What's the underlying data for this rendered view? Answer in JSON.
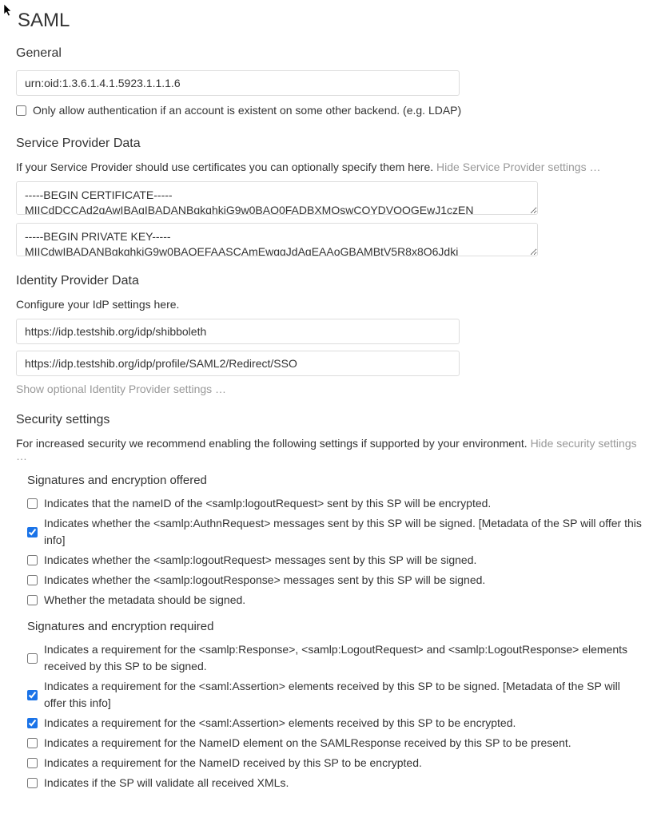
{
  "page": {
    "title": "SAML"
  },
  "general": {
    "title": "General",
    "uid_value": "urn:oid:1.3.6.1.4.1.5923.1.1.1.6",
    "only_allow_label": "Only allow authentication if an account is existent on some other backend. (e.g. LDAP)",
    "only_allow_checked": false
  },
  "sp": {
    "title": "Service Provider Data",
    "helper": "If your Service Provider should use certificates you can optionally specify them here.",
    "toggle_link": "Hide Service Provider settings …",
    "cert_value": "-----BEGIN CERTIFICATE-----\nMIICdDCCAd2gAwIBAgIBADANBgkqhkiG9w0BAQ0FADBXMQswCQYDVQQGEwJ1czEN",
    "key_value": "-----BEGIN PRIVATE KEY-----\nMIICdwIBADANBgkqhkiG9w0BAQEFAASCAmEwggJdAgEAAoGBAMBtV5R8x8O6Jdkj"
  },
  "idp": {
    "title": "Identity Provider Data",
    "helper": "Configure your IdP settings here.",
    "entity_id": "https://idp.testshib.org/idp/shibboleth",
    "sso_url": "https://idp.testshib.org/idp/profile/SAML2/Redirect/SSO",
    "show_link": "Show optional Identity Provider settings …"
  },
  "security": {
    "title": "Security settings",
    "helper": "For increased security we recommend enabling the following settings if supported by your environment.",
    "toggle_link": "Hide security settings …",
    "offered": {
      "title": "Signatures and encryption offered",
      "items": [
        {
          "label": "Indicates that the nameID of the <samlp:logoutRequest> sent by this SP will be encrypted.",
          "checked": false
        },
        {
          "label": "Indicates whether the <samlp:AuthnRequest> messages sent by this SP will be signed. [Metadata of the SP will offer this info]",
          "checked": true
        },
        {
          "label": "Indicates whether the <samlp:logoutRequest> messages sent by this SP will be signed.",
          "checked": false
        },
        {
          "label": "Indicates whether the <samlp:logoutResponse> messages sent by this SP will be signed.",
          "checked": false
        },
        {
          "label": "Whether the metadata should be signed.",
          "checked": false
        }
      ]
    },
    "required": {
      "title": "Signatures and encryption required",
      "items": [
        {
          "label": "Indicates a requirement for the <samlp:Response>, <samlp:LogoutRequest> and <samlp:LogoutResponse> elements received by this SP to be signed.",
          "checked": false
        },
        {
          "label": "Indicates a requirement for the <saml:Assertion> elements received by this SP to be signed. [Metadata of the SP will offer this info]",
          "checked": true
        },
        {
          "label": "Indicates a requirement for the <saml:Assertion> elements received by this SP to be encrypted.",
          "checked": true
        },
        {
          "label": "Indicates a requirement for the NameID element on the SAMLResponse received by this SP to be present.",
          "checked": false
        },
        {
          "label": "Indicates a requirement for the NameID received by this SP to be encrypted.",
          "checked": false
        },
        {
          "label": "Indicates if the SP will validate all received XMLs.",
          "checked": false
        }
      ]
    }
  }
}
